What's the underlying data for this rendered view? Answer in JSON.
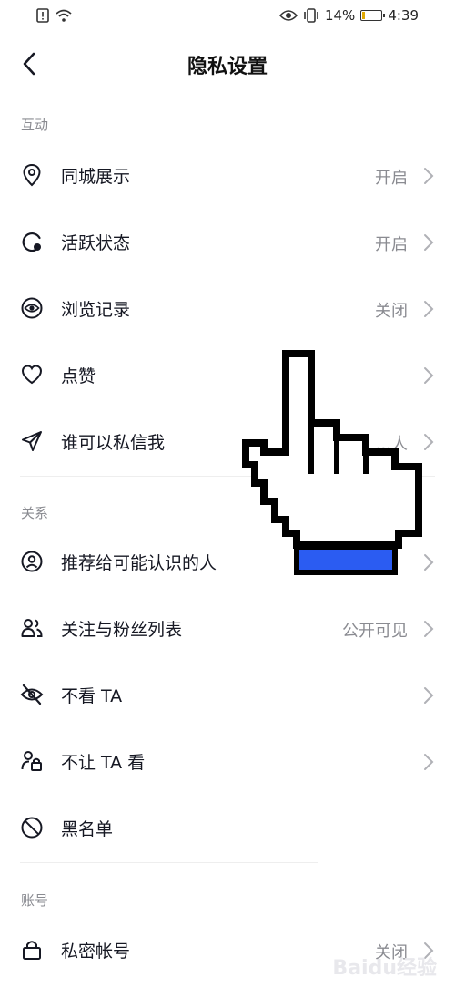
{
  "status_bar": {
    "battery_percent": "14%",
    "time": "4:39",
    "battery_level": 0.14
  },
  "header": {
    "title": "隐私设置"
  },
  "sections": {
    "interaction": {
      "title": "互动",
      "items": [
        {
          "label": "同城展示",
          "value": "开启",
          "icon": "location-icon"
        },
        {
          "label": "活跃状态",
          "value": "开启",
          "icon": "activity-status-icon"
        },
        {
          "label": "浏览记录",
          "value": "关闭",
          "icon": "eye-icon"
        },
        {
          "label": "点赞",
          "value": "",
          "icon": "heart-icon"
        },
        {
          "label": "谁可以私信我",
          "value": "...人",
          "icon": "paper-plane-icon"
        }
      ]
    },
    "relations": {
      "title": "关系",
      "items": [
        {
          "label": "推荐给可能认识的人",
          "value": "",
          "icon": "person-circle-icon"
        },
        {
          "label": "关注与粉丝列表",
          "value": "公开可见",
          "icon": "users-icon"
        },
        {
          "label": "不看 TA",
          "value": "",
          "icon": "eye-slash-icon"
        },
        {
          "label": "不让 TA 看",
          "value": "",
          "icon": "person-lock-icon"
        },
        {
          "label": "黑名单",
          "value": "",
          "icon": "block-icon"
        }
      ]
    },
    "account": {
      "title": "账号",
      "items": [
        {
          "label": "私密帐号",
          "value": "关闭",
          "icon": "lock-icon"
        }
      ]
    }
  },
  "watermark": "Baidu经验"
}
